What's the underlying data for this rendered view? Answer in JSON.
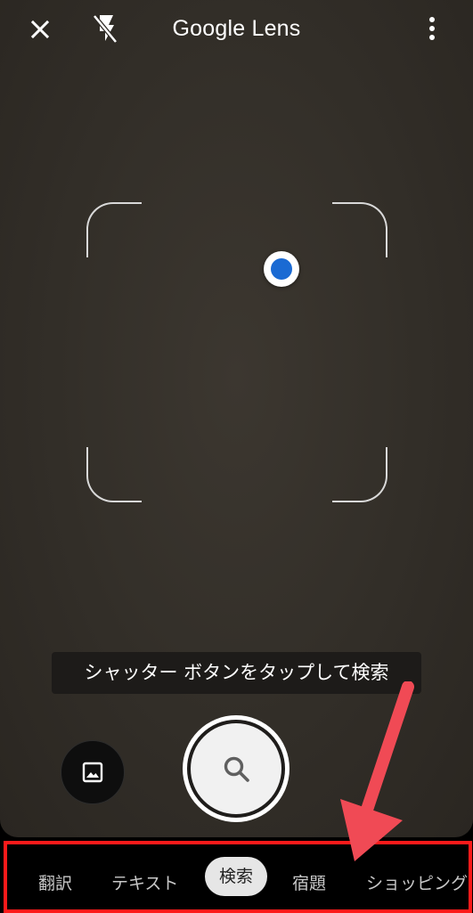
{
  "app": {
    "title": "Google Lens"
  },
  "hint": {
    "text": "シャッター ボタンをタップして検索"
  },
  "icons": {
    "close": "close-icon",
    "flash": "flash-off-icon",
    "menu": "more-vert-icon",
    "gallery": "image-icon",
    "shutter": "search-icon"
  },
  "tabs": [
    {
      "label": "翻訳",
      "active": false
    },
    {
      "label": "テキスト",
      "active": false
    },
    {
      "label": "検索",
      "active": true
    },
    {
      "label": "宿題",
      "active": false
    },
    {
      "label": "ショッピング",
      "active": false
    }
  ],
  "colors": {
    "focus_dot": "#1a6ad3",
    "annotation_red": "#ff1a1a",
    "arrow": "#f04a55"
  }
}
